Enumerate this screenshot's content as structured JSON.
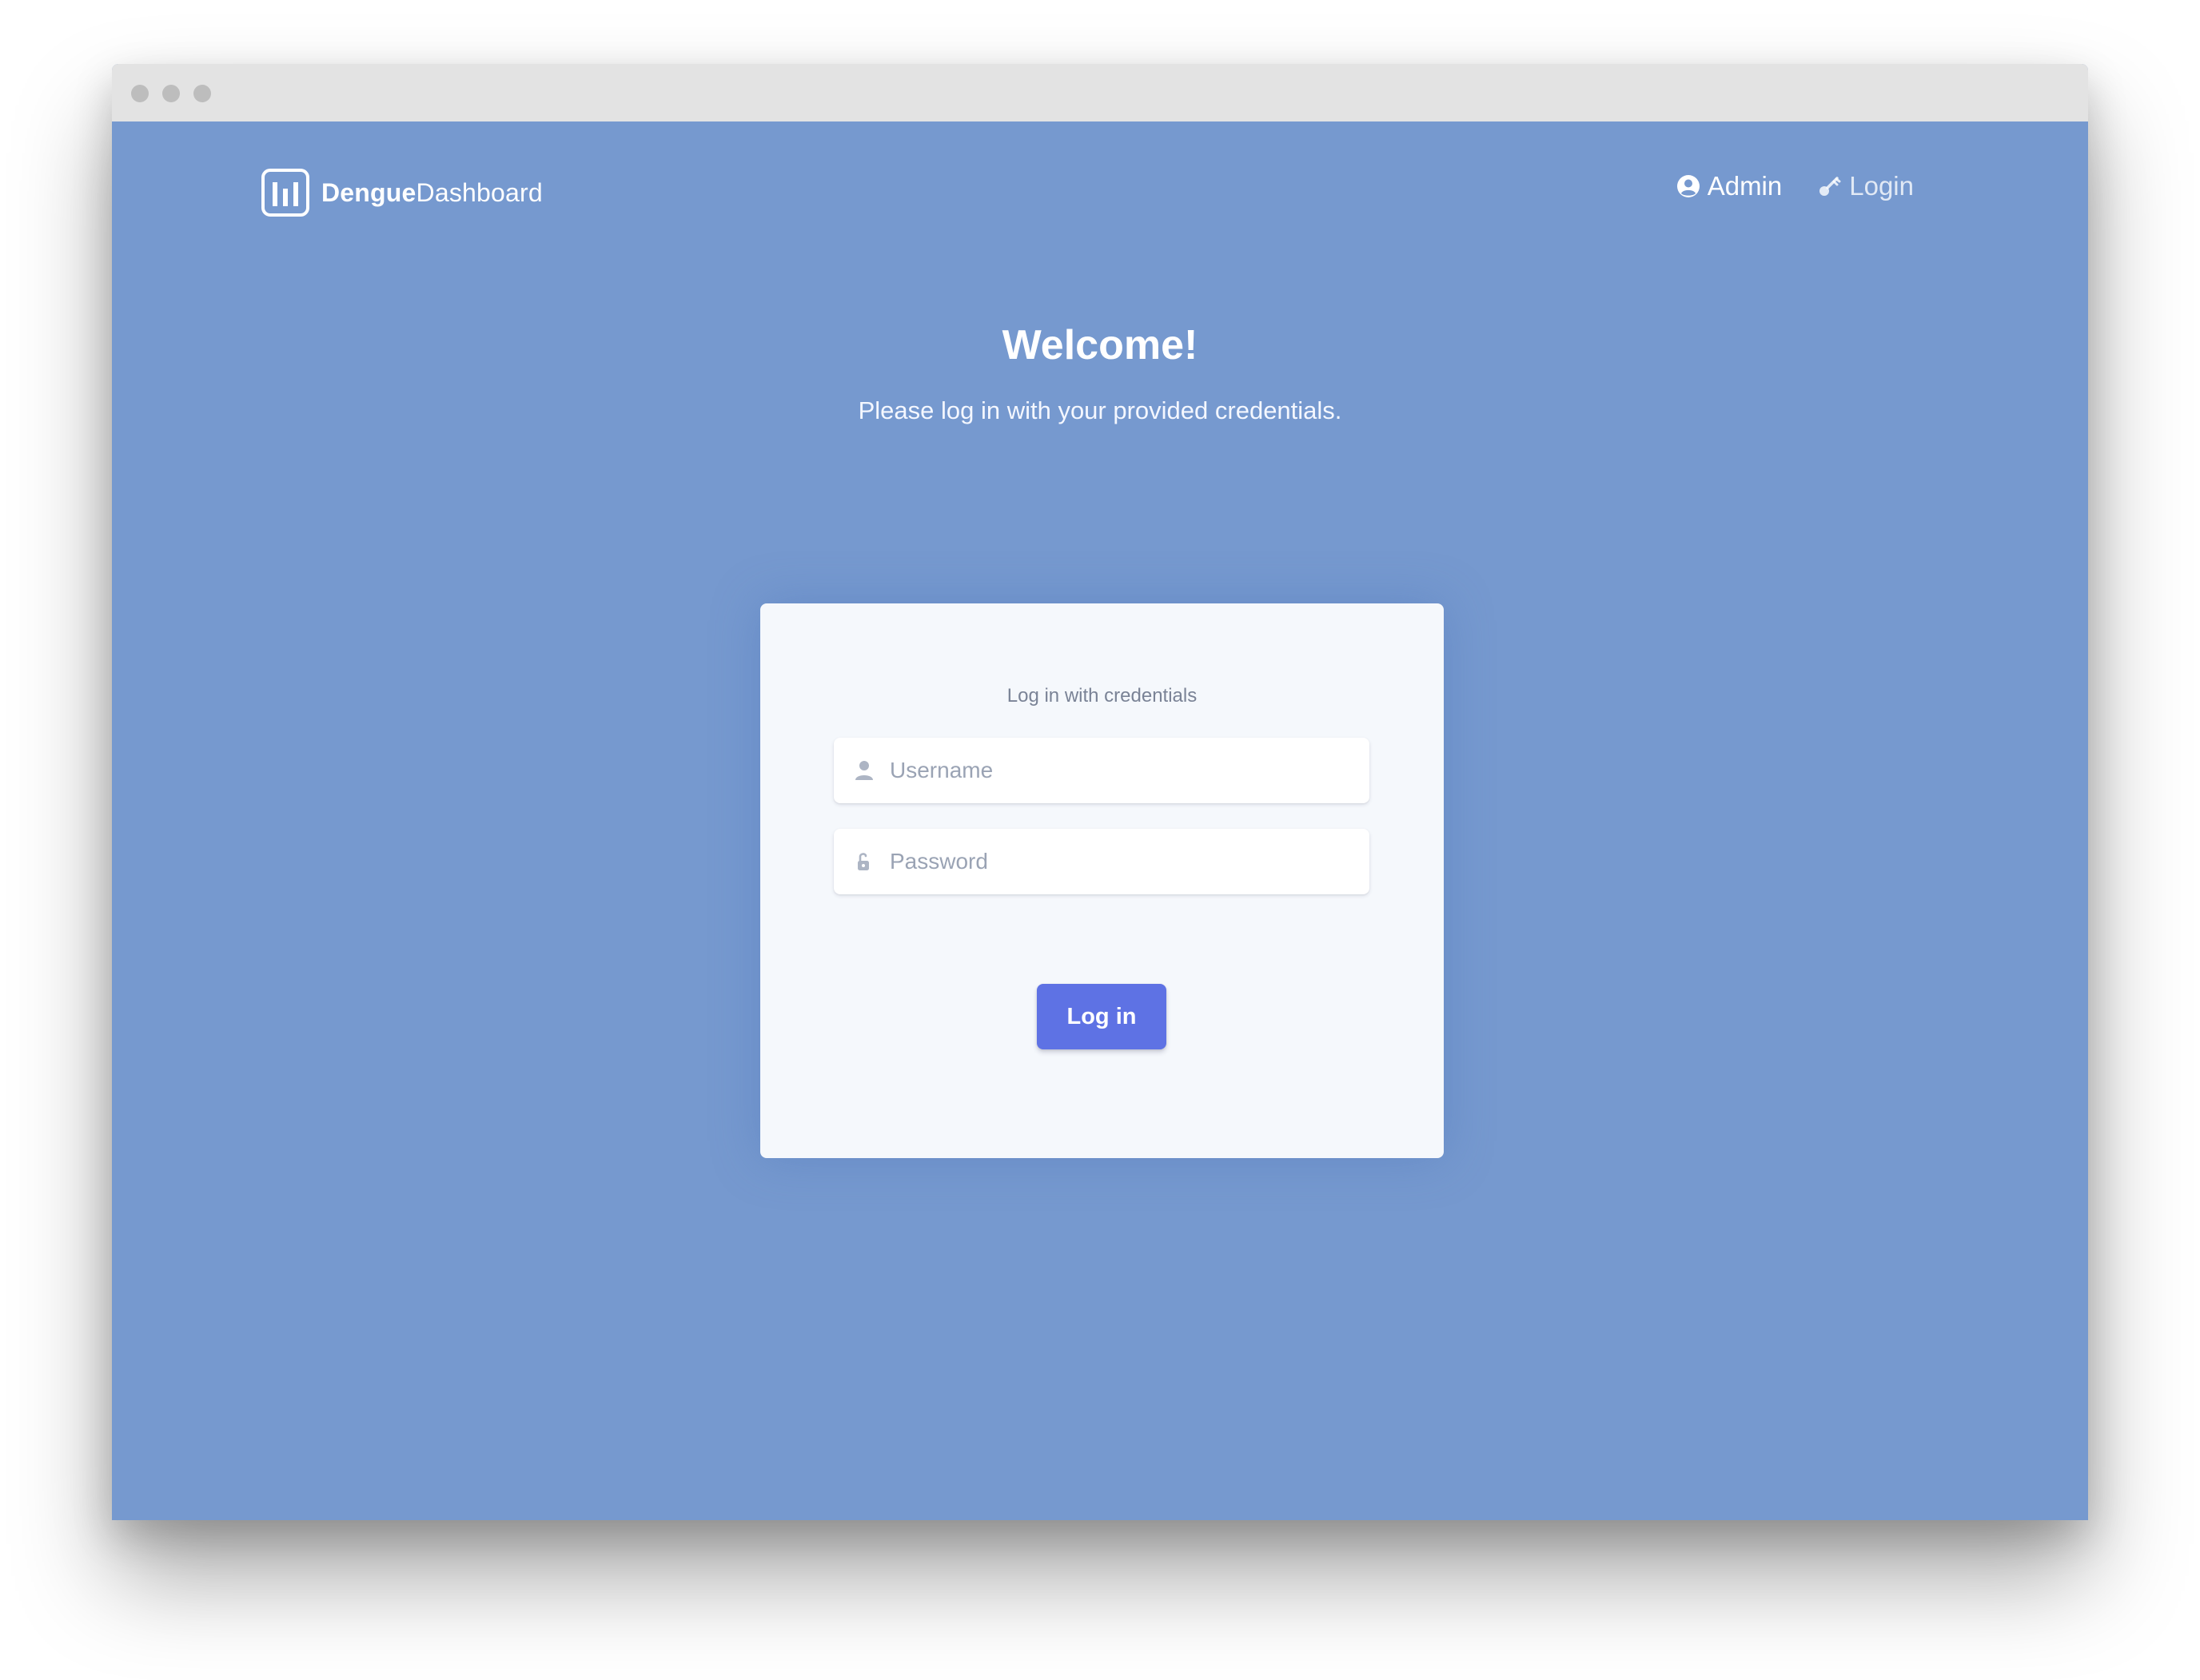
{
  "brand": {
    "name_strong": "Dengue",
    "name_light": "Dashboard",
    "logo_icon": "bar-chart-icon"
  },
  "nav": {
    "items": [
      {
        "label": "Admin",
        "icon": "user-circle-icon"
      },
      {
        "label": "Login",
        "icon": "key-icon"
      }
    ]
  },
  "hero": {
    "title": "Welcome!",
    "subtitle": "Please log in with your provided credentials."
  },
  "login_card": {
    "caption": "Log in with credentials",
    "username_placeholder": "Username",
    "password_placeholder": "Password",
    "submit_label": "Log in"
  },
  "colors": {
    "background": "#7699cf",
    "card": "#f5f8fc",
    "primary_button": "#5e72e4",
    "titlebar": "#e3e3e3"
  }
}
